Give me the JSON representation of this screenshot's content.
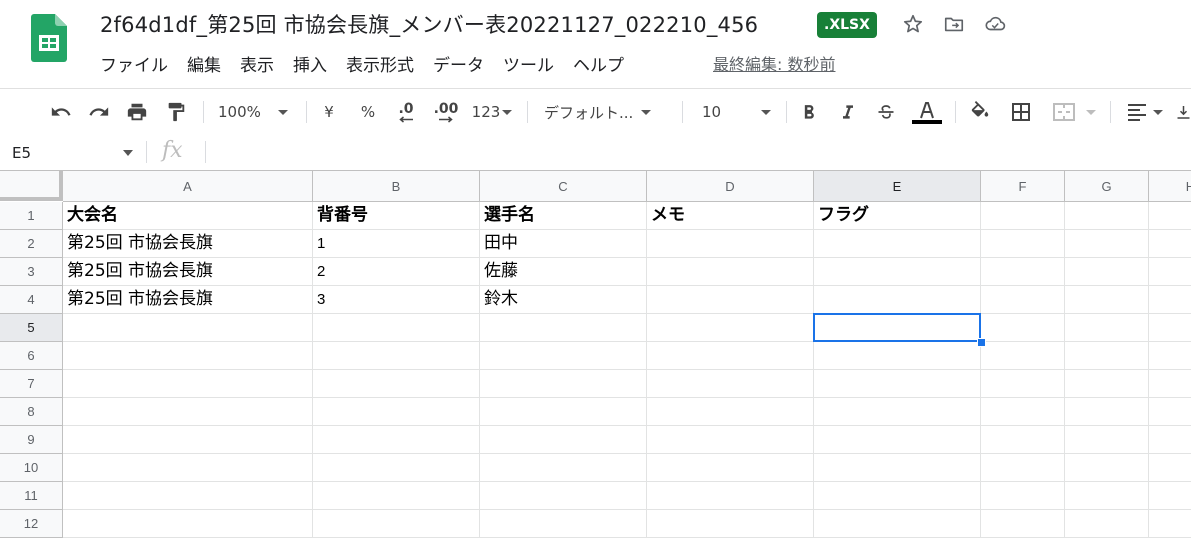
{
  "header": {
    "title": "2f64d1df_第25回 市協会長旗_メンバー表20221127_022210_456",
    "badge": ".XLSX",
    "menu": [
      "ファイル",
      "編集",
      "表示",
      "挿入",
      "表示形式",
      "データ",
      "ツール",
      "ヘルプ"
    ],
    "last_edit": "最終編集: 数秒前"
  },
  "toolbar": {
    "zoom": "100%",
    "currency": "¥",
    "percent": "%",
    "decimal_decrease": ".0",
    "decimal_increase": ".00",
    "number_format": "123",
    "font": "デフォルト...",
    "font_size": "10"
  },
  "formula_bar": {
    "name_box": "E5",
    "fx": "fx",
    "value": ""
  },
  "grid": {
    "columns": [
      "A",
      "B",
      "C",
      "D",
      "E",
      "F",
      "G",
      "H"
    ],
    "rows": [
      "1",
      "2",
      "3",
      "4",
      "5",
      "6",
      "7",
      "8",
      "9",
      "10",
      "11",
      "12"
    ],
    "selected_cell": "E5",
    "cells": {
      "A1": "大会名",
      "B1": "背番号",
      "C1": "選手名",
      "D1": "メモ",
      "E1": "フラグ",
      "A2": "第25回 市協会長旗",
      "B2": "1",
      "C2": "田中",
      "A3": "第25回 市協会長旗",
      "B3": "2",
      "C3": "佐藤",
      "A4": "第25回 市協会長旗",
      "B4": "3",
      "C4": "鈴木"
    }
  },
  "colors": {
    "brand_green": "#188038",
    "selection_blue": "#1a73e8"
  }
}
